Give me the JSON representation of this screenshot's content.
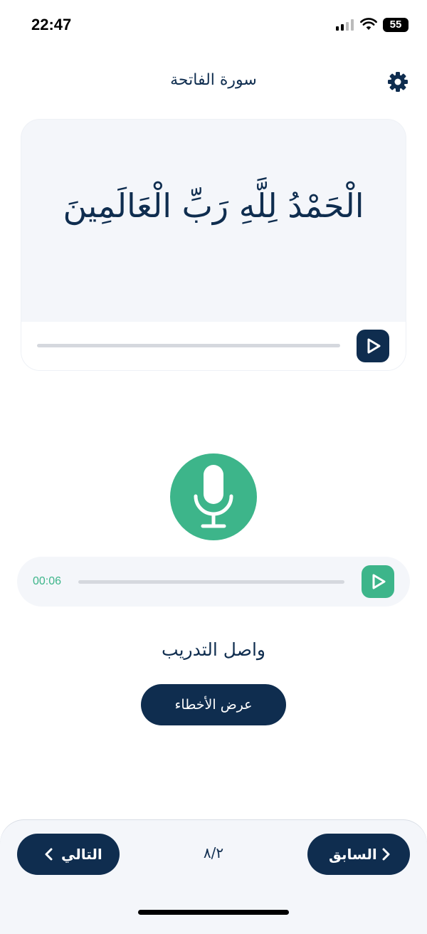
{
  "status": {
    "time": "22:47",
    "battery": "55"
  },
  "header": {
    "title": "سورة الفاتحة",
    "settings_icon": "gear-icon"
  },
  "verse_card": {
    "verse": "الْحَمْدُ لِلَّهِ رَبِّ الْعَالَمِينَ",
    "play_icon": "play-icon"
  },
  "recorder": {
    "mic_icon": "microphone-icon"
  },
  "recording": {
    "duration": "00:06",
    "play_icon": "play-icon"
  },
  "feedback": {
    "message": "واصل التدريب",
    "show_errors_label": "عرض الأخطاء"
  },
  "navigation": {
    "next_label": "التالي",
    "prev_label": "السابق",
    "page_indicator": "٨/٢"
  },
  "colors": {
    "primary": "#0f2d4f",
    "accent": "#3db58a",
    "card_bg": "#f4f6fa"
  }
}
